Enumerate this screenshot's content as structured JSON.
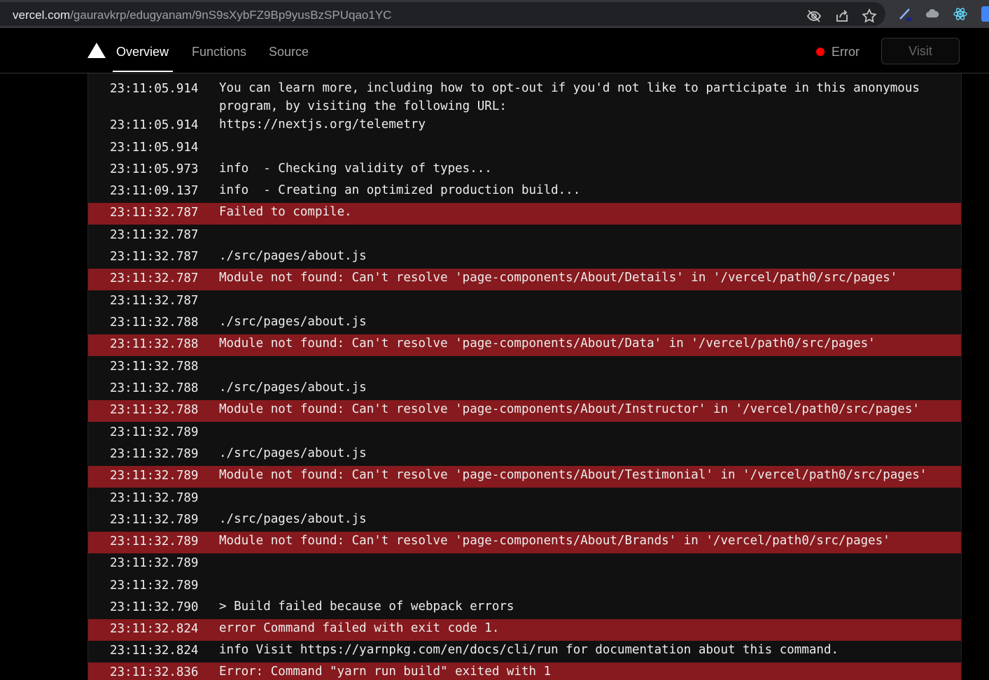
{
  "browser": {
    "url_host": "vercel.com",
    "url_path": "/gauravkrp/edugyanam/9nS9sXybFZ9Bp9yusBzSPUqao1YC",
    "icons": [
      "eye-off-icon",
      "share-icon",
      "star-icon",
      "pen-extension-icon",
      "cloud-extension-icon",
      "react-extension-icon"
    ]
  },
  "header": {
    "tabs": [
      {
        "label": "Overview",
        "active": true
      },
      {
        "label": "Functions",
        "active": false
      },
      {
        "label": "Source",
        "active": false
      }
    ],
    "status_label": "Error",
    "status_color": "#ff0000",
    "visit_label": "Visit"
  },
  "logs": [
    {
      "time": "23:11:05.914",
      "msg": "You can learn more, including how to opt-out if you'd not like to participate in this anonymous program, by visiting the following URL:",
      "error": false
    },
    {
      "time": "23:11:05.914",
      "msg": "https://nextjs.org/telemetry",
      "error": false
    },
    {
      "time": "23:11:05.914",
      "msg": "",
      "error": false
    },
    {
      "time": "23:11:05.973",
      "msg": "info  - Checking validity of types...",
      "error": false
    },
    {
      "time": "23:11:09.137",
      "msg": "info  - Creating an optimized production build...",
      "error": false
    },
    {
      "time": "23:11:32.787",
      "msg": "Failed to compile.",
      "error": true
    },
    {
      "time": "23:11:32.787",
      "msg": "",
      "error": false
    },
    {
      "time": "23:11:32.787",
      "msg": "./src/pages/about.js",
      "error": false
    },
    {
      "time": "23:11:32.787",
      "msg": "Module not found: Can't resolve 'page-components/About/Details' in '/vercel/path0/src/pages'",
      "error": true
    },
    {
      "time": "23:11:32.787",
      "msg": "",
      "error": false
    },
    {
      "time": "23:11:32.788",
      "msg": "./src/pages/about.js",
      "error": false
    },
    {
      "time": "23:11:32.788",
      "msg": "Module not found: Can't resolve 'page-components/About/Data' in '/vercel/path0/src/pages'",
      "error": true
    },
    {
      "time": "23:11:32.788",
      "msg": "",
      "error": false
    },
    {
      "time": "23:11:32.788",
      "msg": "./src/pages/about.js",
      "error": false
    },
    {
      "time": "23:11:32.788",
      "msg": "Module not found: Can't resolve 'page-components/About/Instructor' in '/vercel/path0/src/pages'",
      "error": true
    },
    {
      "time": "23:11:32.789",
      "msg": "",
      "error": false
    },
    {
      "time": "23:11:32.789",
      "msg": "./src/pages/about.js",
      "error": false
    },
    {
      "time": "23:11:32.789",
      "msg": "Module not found: Can't resolve 'page-components/About/Testimonial' in '/vercel/path0/src/pages'",
      "error": true
    },
    {
      "time": "23:11:32.789",
      "msg": "",
      "error": false
    },
    {
      "time": "23:11:32.789",
      "msg": "./src/pages/about.js",
      "error": false
    },
    {
      "time": "23:11:32.789",
      "msg": "Module not found: Can't resolve 'page-components/About/Brands' in '/vercel/path0/src/pages'",
      "error": true
    },
    {
      "time": "23:11:32.789",
      "msg": "",
      "error": false
    },
    {
      "time": "23:11:32.789",
      "msg": "",
      "error": false
    },
    {
      "time": "23:11:32.790",
      "msg": "> Build failed because of webpack errors",
      "error": false
    },
    {
      "time": "23:11:32.824",
      "msg": "error Command failed with exit code 1.",
      "error": true
    },
    {
      "time": "23:11:32.824",
      "msg": "info Visit https://yarnpkg.com/en/docs/cli/run for documentation about this command.",
      "error": false
    },
    {
      "time": "23:11:32.836",
      "msg": "Error: Command \"yarn run build\" exited with 1",
      "error": true
    }
  ]
}
